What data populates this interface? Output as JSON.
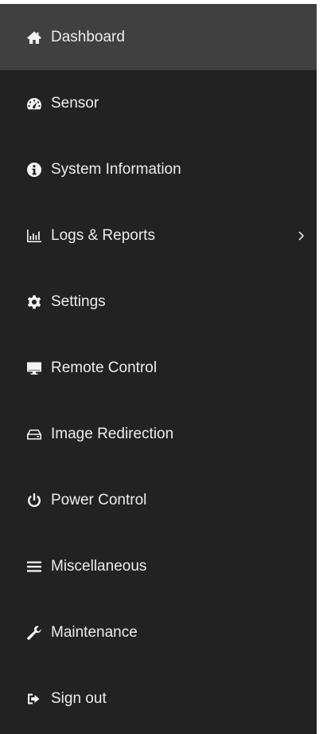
{
  "sidebar": {
    "background": "#222222",
    "active_background": "#404040",
    "items": [
      {
        "label": "Dashboard",
        "icon": "home-icon",
        "active": true
      },
      {
        "label": "Sensor",
        "icon": "tachometer-icon"
      },
      {
        "label": "System Information",
        "icon": "info-circle-icon"
      },
      {
        "label": "Logs & Reports",
        "icon": "bar-chart-icon",
        "expandable": true,
        "chevron_icon": "chevron-right-icon"
      },
      {
        "label": "Settings",
        "icon": "gear-icon"
      },
      {
        "label": "Remote Control",
        "icon": "monitor-icon"
      },
      {
        "label": "Image Redirection",
        "icon": "hdd-icon"
      },
      {
        "label": "Power Control",
        "icon": "power-icon"
      },
      {
        "label": "Miscellaneous",
        "icon": "bars-icon"
      },
      {
        "label": "Maintenance",
        "icon": "wrench-icon"
      },
      {
        "label": "Sign out",
        "icon": "sign-out-icon"
      }
    ]
  }
}
